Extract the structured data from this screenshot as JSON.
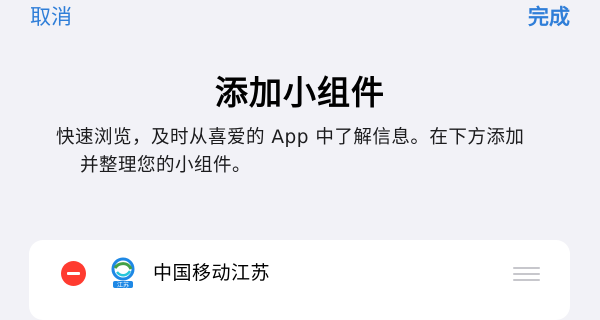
{
  "nav": {
    "cancel_label": "取消",
    "done_label": "完成"
  },
  "header": {
    "title": "添加小组件",
    "description_line1": "快速浏览，及时从喜爱的 App 中了解信息。在下方添加",
    "description_line2": "并整理您的小组件。"
  },
  "widget_list": {
    "items": [
      {
        "label": "中国移动江苏",
        "icon": "china-mobile-icon",
        "icon_text": "江苏"
      }
    ]
  },
  "colors": {
    "accent": "#2f7ed8",
    "remove": "#ff3b30",
    "background": "#f2f2f7"
  }
}
